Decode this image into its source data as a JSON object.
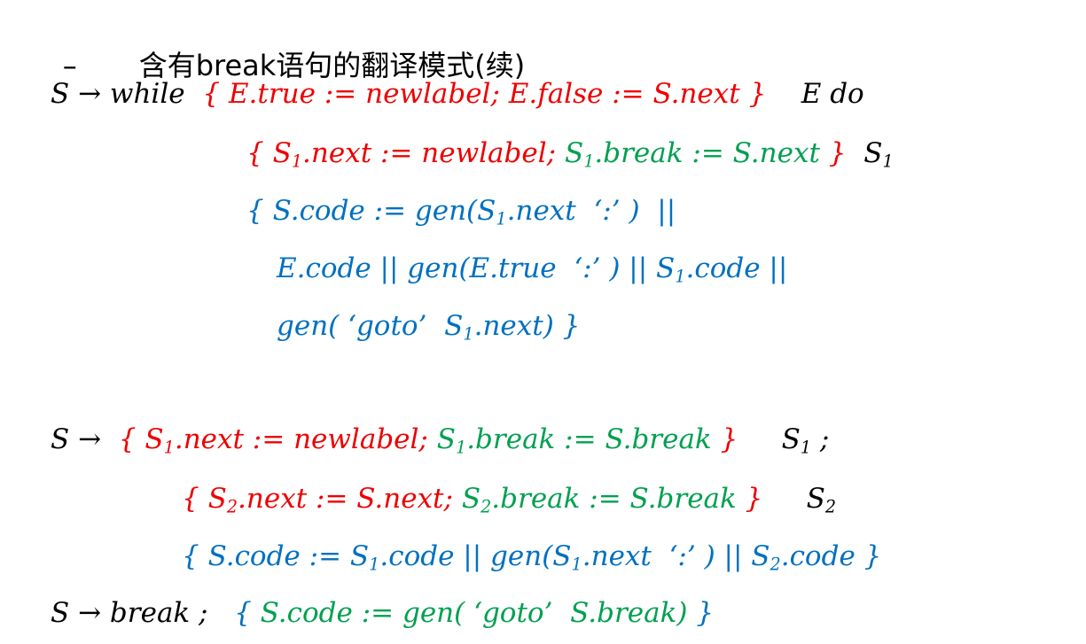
{
  "title": {
    "bullet": "–",
    "text": "含有break语句的翻译模式(续)"
  },
  "colors": {
    "black": "#000000",
    "red": "#ee0000",
    "green": "#00a050",
    "blue": "#0070c0"
  },
  "lines": [
    [
      [
        "bk",
        "S "
      ],
      [
        "bk",
        "→"
      ],
      [
        "bk",
        " while  "
      ],
      [
        "rd",
        "{ E.true := newlabel; E.false := S.next }"
      ],
      [
        "bk",
        "    E do"
      ]
    ],
    [
      [
        "rd",
        "{ S"
      ],
      [
        "rd",
        "1",
        1
      ],
      [
        "rd",
        ".next := newlabel; "
      ],
      [
        "gr",
        "S"
      ],
      [
        "gr",
        "1",
        1
      ],
      [
        "gr",
        ".break := S.next"
      ],
      [
        "rd",
        " }"
      ],
      [
        "bk",
        "  S"
      ],
      [
        "bk",
        "1",
        1
      ]
    ],
    [
      [
        "bl",
        "{ S.code := gen(S"
      ],
      [
        "bl",
        "1",
        1
      ],
      [
        "bl",
        ".next  ‘:’ )  ||"
      ]
    ],
    [
      [
        "bl",
        "E.code || gen(E.true  ‘:’ ) || S"
      ],
      [
        "bl",
        "1",
        1
      ],
      [
        "bl",
        ".code ||"
      ]
    ],
    [
      [
        "bl",
        "gen( ‘goto’  S"
      ],
      [
        "bl",
        "1",
        1
      ],
      [
        "bl",
        ".next) }"
      ]
    ],
    [
      [
        "bk",
        "S "
      ],
      [
        "bk",
        "→"
      ],
      [
        "bk",
        "  "
      ],
      [
        "rd",
        "{ S"
      ],
      [
        "rd",
        "1",
        1
      ],
      [
        "rd",
        ".next := newlabel; "
      ],
      [
        "gr",
        "S"
      ],
      [
        "gr",
        "1",
        1
      ],
      [
        "gr",
        ".break := S.break"
      ],
      [
        "rd",
        " }"
      ],
      [
        "bk",
        "     S"
      ],
      [
        "bk",
        "1",
        1
      ],
      [
        "bk",
        " ;"
      ]
    ],
    [
      [
        "rd",
        "{ S"
      ],
      [
        "rd",
        "2",
        1
      ],
      [
        "rd",
        ".next := S.next; "
      ],
      [
        "gr",
        "S"
      ],
      [
        "gr",
        "2",
        1
      ],
      [
        "gr",
        ".break := S.break"
      ],
      [
        "rd",
        " }"
      ],
      [
        "bk",
        "     S"
      ],
      [
        "bk",
        "2",
        1
      ]
    ],
    [
      [
        "bl",
        "{ S.code := S"
      ],
      [
        "bl",
        "1",
        1
      ],
      [
        "bl",
        ".code || gen(S"
      ],
      [
        "bl",
        "1",
        1
      ],
      [
        "bl",
        ".next  ‘:’ ) || S"
      ],
      [
        "bl",
        "2",
        1
      ],
      [
        "bl",
        ".code }"
      ]
    ],
    [
      [
        "bk",
        "S "
      ],
      [
        "bk",
        "→"
      ],
      [
        "bk",
        " break ;   "
      ],
      [
        "bl",
        "{ "
      ],
      [
        "gr",
        "S.code := gen( ‘goto’  S.break)"
      ],
      [
        "bl",
        " }"
      ]
    ]
  ]
}
